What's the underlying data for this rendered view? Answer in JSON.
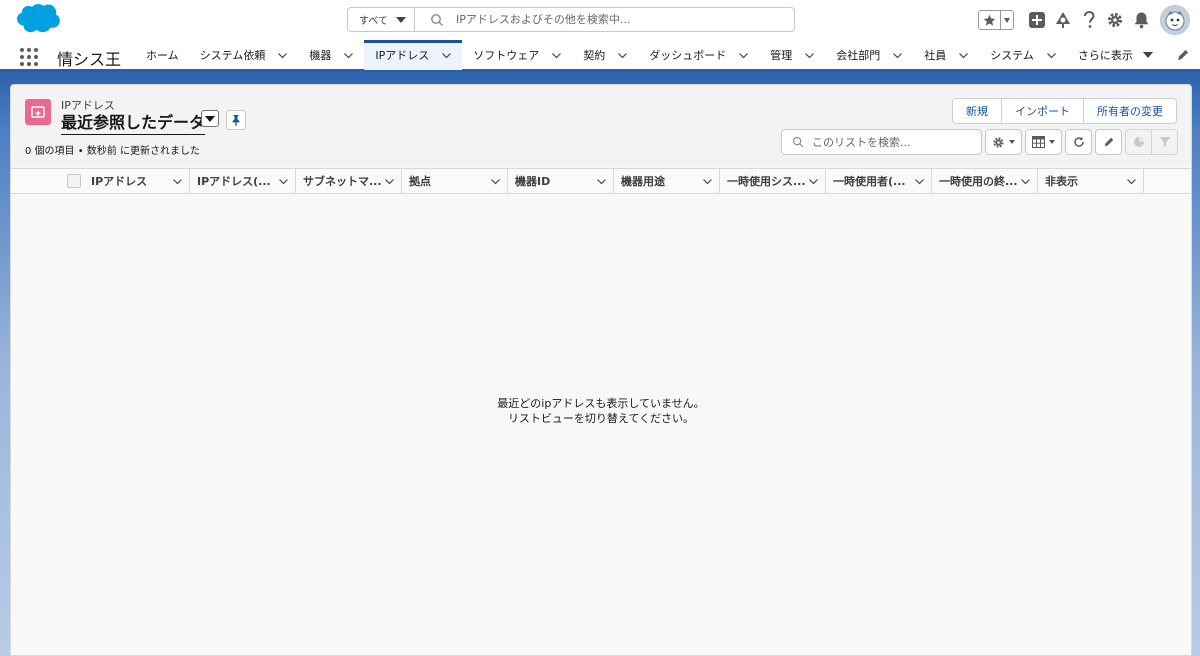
{
  "search": {
    "scope_label": "すべて",
    "placeholder": "IPアドレスおよびその他を検索中..."
  },
  "app": {
    "name": "情シス王"
  },
  "nav": {
    "items": [
      {
        "label": "ホーム",
        "has_menu": false
      },
      {
        "label": "システム依頼",
        "has_menu": true
      },
      {
        "label": "機器",
        "has_menu": true
      },
      {
        "label": "IPアドレス",
        "has_menu": true,
        "active": true
      },
      {
        "label": "ソフトウェア",
        "has_menu": true
      },
      {
        "label": "契約",
        "has_menu": true
      },
      {
        "label": "ダッシュボード",
        "has_menu": true
      },
      {
        "label": "管理",
        "has_menu": true
      },
      {
        "label": "会社部門",
        "has_menu": true
      },
      {
        "label": "社員",
        "has_menu": true
      },
      {
        "label": "システム",
        "has_menu": true
      }
    ],
    "more_label": "さらに表示"
  },
  "list_view": {
    "object_label": "IPアドレス",
    "view_name": "最近参照したデータ",
    "status": "0 個の項目 • 数秒前 に更新されました",
    "buttons": {
      "new": "新規",
      "import": "インポート",
      "change_owner": "所有者の変更"
    },
    "search_placeholder": "このリストを検索...",
    "columns": [
      "IPアドレス",
      "IPアドレス(...",
      "サブネットマ...",
      "拠点",
      "機器ID",
      "機器用途",
      "一時使用シス...",
      "一時使用者(...",
      "一時使用の終...",
      "非表示"
    ],
    "empty_line1": "最近どのipアドレスも表示していません。",
    "empty_line2": "リストビューを切り替えてください。"
  },
  "colors": {
    "brand": "#00a1e0",
    "nav_active": "#1b5297",
    "object_icon": "#e96a8e",
    "link": "#1b5297"
  },
  "icons": [
    "salesforce-cloud-logo",
    "search-icon",
    "star-icon",
    "add-icon",
    "trailhead-icon",
    "help-icon",
    "gear-icon",
    "bell-icon",
    "avatar-icon",
    "app-launcher-icon",
    "chevron-down-icon",
    "pencil-icon",
    "pin-icon",
    "refresh-icon",
    "table-icon",
    "chart-icon",
    "filter-icon"
  ]
}
